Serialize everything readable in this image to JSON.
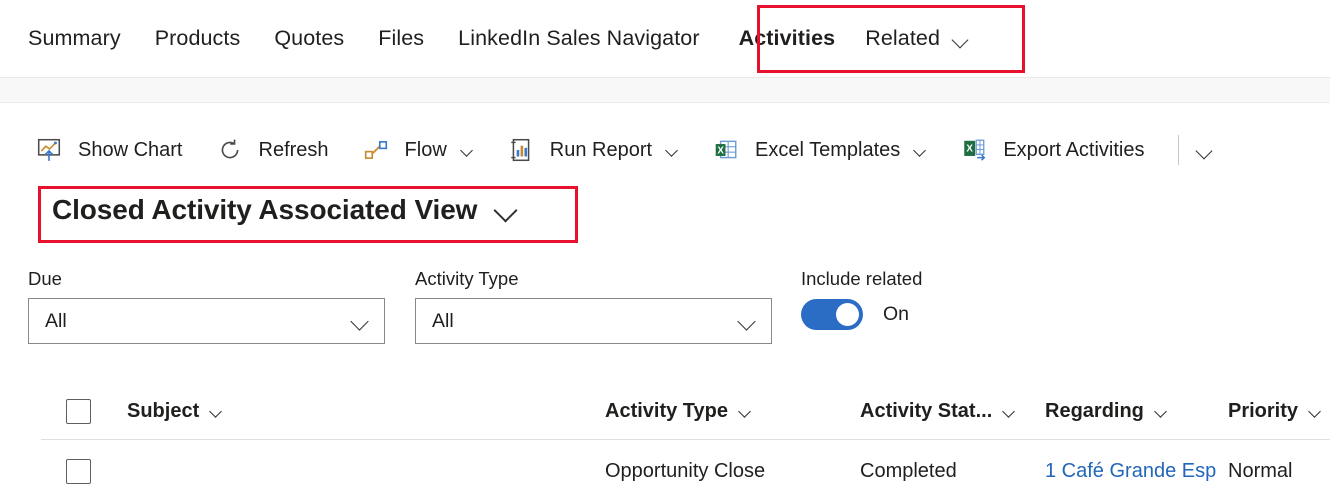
{
  "tabs": [
    {
      "label": "Summary",
      "active": false
    },
    {
      "label": "Products",
      "active": false
    },
    {
      "label": "Quotes",
      "active": false
    },
    {
      "label": "Files",
      "active": false
    },
    {
      "label": "LinkedIn Sales Navigator",
      "active": false
    },
    {
      "label": "Activities",
      "active": true
    },
    {
      "label": "Related",
      "active": false
    }
  ],
  "commandbar": {
    "show_chart": "Show Chart",
    "refresh": "Refresh",
    "flow": "Flow",
    "run_report": "Run Report",
    "excel_templates": "Excel Templates",
    "export_activities": "Export Activities"
  },
  "view_selector": {
    "title": "Closed Activity Associated View"
  },
  "filters": {
    "due": {
      "label": "Due",
      "value": "All"
    },
    "activity_type": {
      "label": "Activity Type",
      "value": "All"
    },
    "include_related": {
      "label": "Include related",
      "state": "On"
    }
  },
  "grid": {
    "columns": [
      "Subject",
      "Activity Type",
      "Activity Stat...",
      "Regarding",
      "Priority"
    ],
    "rows": [
      {
        "subject": "",
        "activity_type": "Opportunity Close",
        "activity_status": "Completed",
        "regarding": "1 Café Grande Esp",
        "priority": "Normal"
      }
    ]
  },
  "colors": {
    "highlight_box": "#e8112d",
    "link": "#2266b8",
    "toggle_on": "#2b6cc4"
  }
}
